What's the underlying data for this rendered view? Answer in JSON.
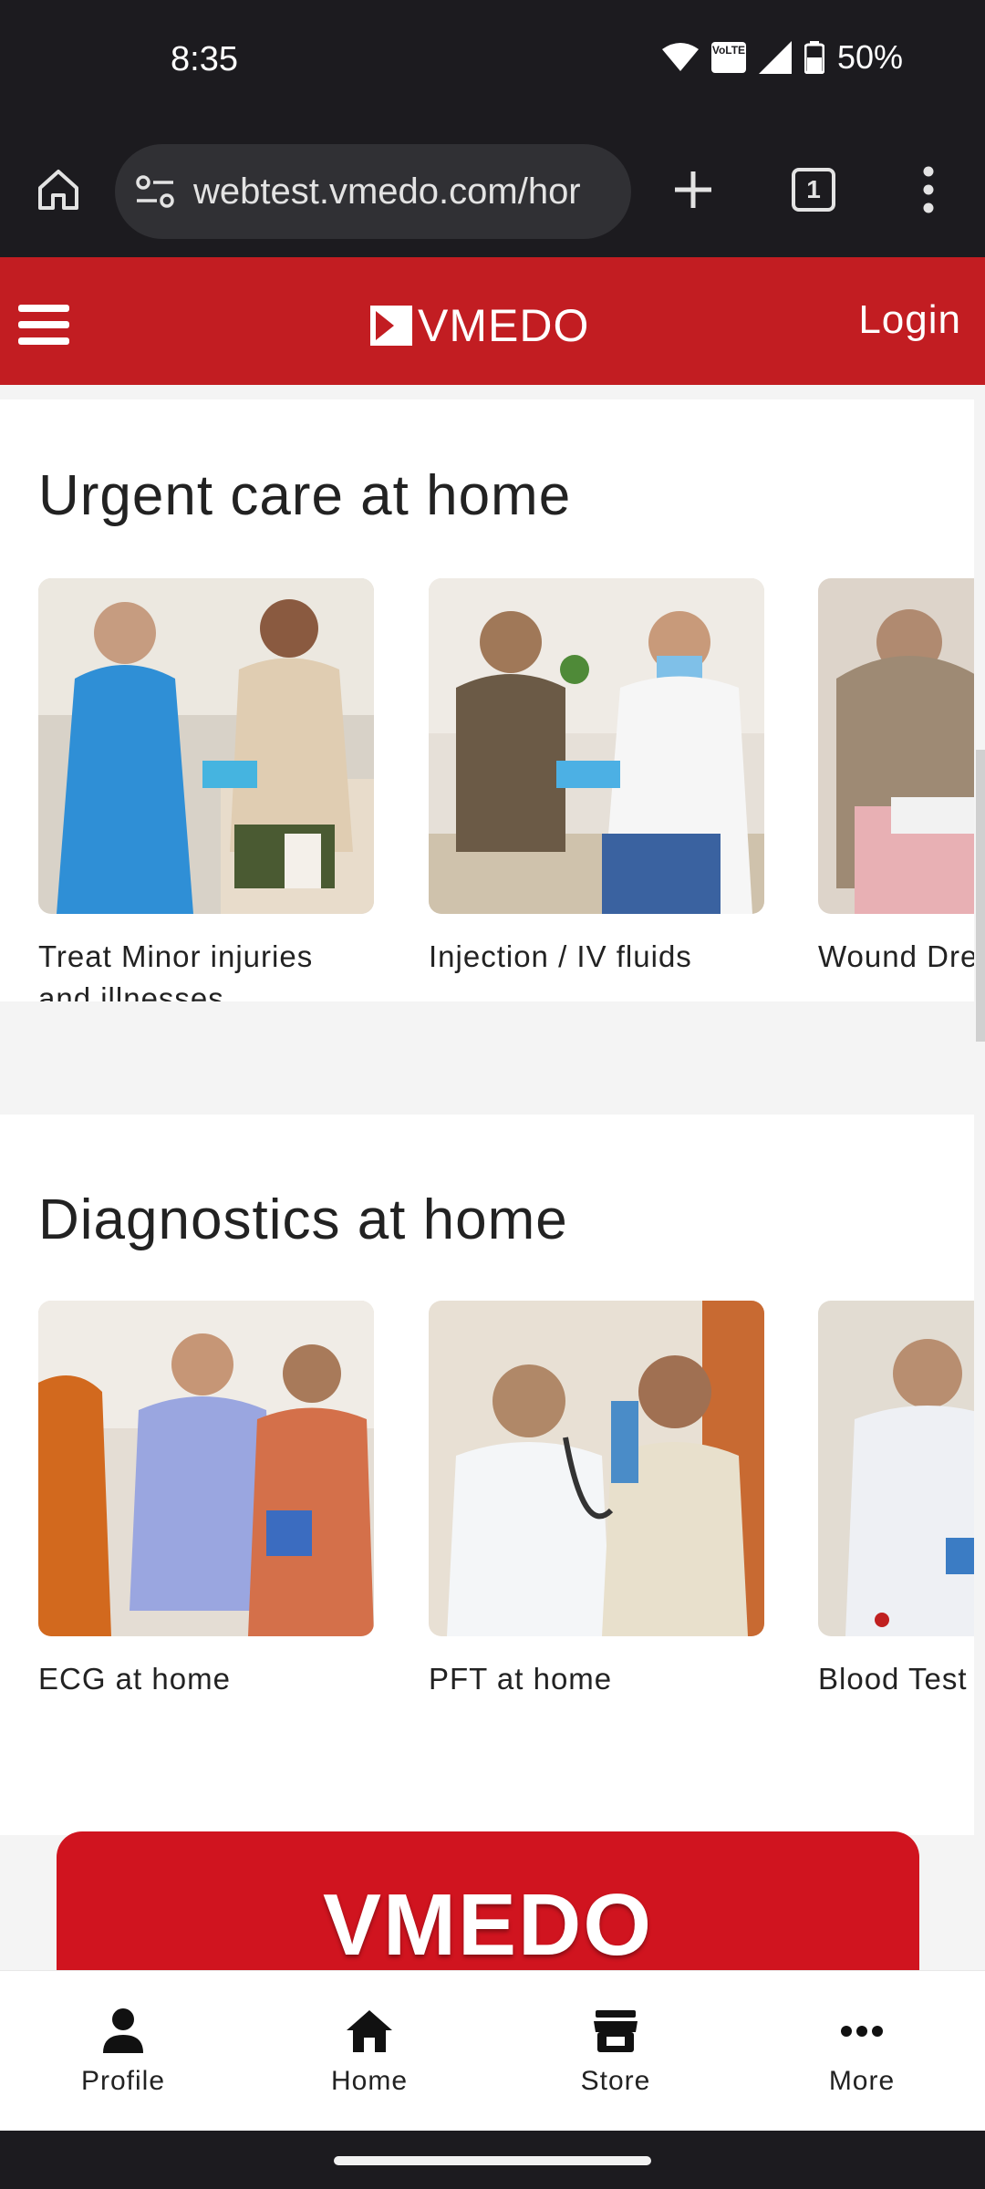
{
  "status": {
    "time": "8:35",
    "battery": "50%",
    "network": "VoLTE"
  },
  "browser": {
    "url": "webtest.vmedo.com/hor",
    "tab_count": "1"
  },
  "header": {
    "logo": "VMEDO",
    "login": "Login"
  },
  "urgent": {
    "title": "Urgent care at home",
    "cards": [
      {
        "label": "Treat Minor injuries and illnesses"
      },
      {
        "label": "Injection / IV fluids"
      },
      {
        "label": "Wound Dre"
      }
    ]
  },
  "diagnostics": {
    "title": "Diagnostics at home",
    "cards": [
      {
        "label": "ECG at home"
      },
      {
        "label": "PFT at home"
      },
      {
        "label": "Blood Test"
      }
    ]
  },
  "banner": {
    "text": "VMEDO"
  },
  "nav": [
    {
      "label": "Profile",
      "icon": "person-icon"
    },
    {
      "label": "Home",
      "icon": "home-icon"
    },
    {
      "label": "Store",
      "icon": "store-icon"
    },
    {
      "label": "More",
      "icon": "more-dots-icon"
    }
  ],
  "colors": {
    "brand": "#c21d22",
    "dark": "#1c1b1f"
  }
}
